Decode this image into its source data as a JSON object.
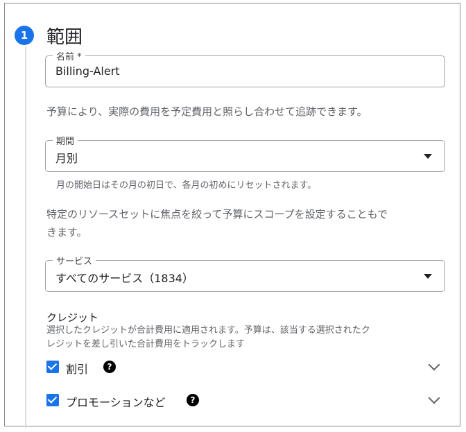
{
  "step": {
    "number": "1",
    "title": "範囲"
  },
  "name_field": {
    "label": "名前 *",
    "value": "Billing-Alert"
  },
  "scope_description": "予算により、実際の費用を予定費用と照らし合わせて追跡できます。",
  "period_field": {
    "label": "期間",
    "value": "月別",
    "hint": "月の開始日はその月の初日で、各月の初めにリセットされます。"
  },
  "resource_description_line1": "特定のリソースセットに焦点を絞って予算にスコープを設定することもで",
  "resource_description_line2": "きます。",
  "services_field": {
    "label": "サービス",
    "value": "すべてのサービス（1834）"
  },
  "credits": {
    "title": "クレジット",
    "description_line1": "選択したクレジットが合計費用に適用されます。予算は、該当する選択されたク",
    "description_line2": "レジットを差し引いた合計費用をトラックします",
    "items": [
      {
        "label": "割引",
        "checked": true
      },
      {
        "label": "プロモーションなど",
        "checked": true
      }
    ]
  },
  "help_glyph": "?",
  "colors": {
    "accent": "#1a73e8"
  }
}
